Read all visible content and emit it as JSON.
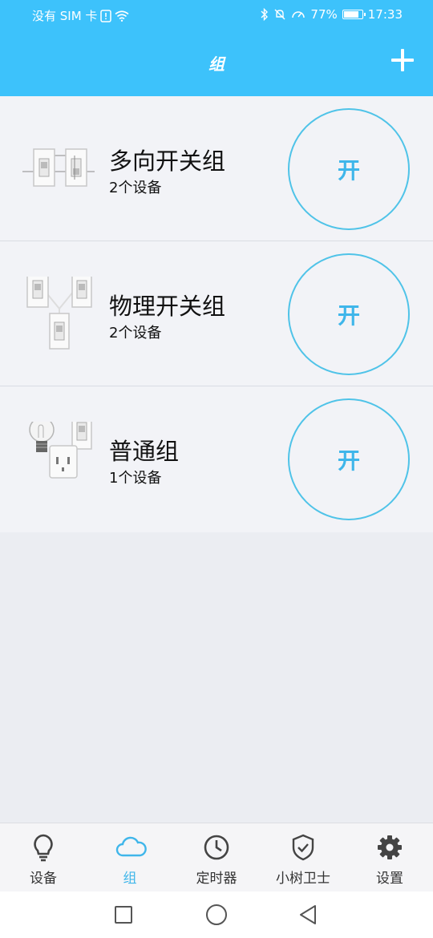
{
  "status_bar": {
    "carrier": "没有 SIM 卡",
    "battery": "77%",
    "time": "17:33"
  },
  "header": {
    "title": "组",
    "add_icon": "plus-icon"
  },
  "groups": [
    {
      "name": "多向开关组",
      "count": "2个设备",
      "button": "开",
      "icon": "multi-switch-group-icon"
    },
    {
      "name": "物理开关组",
      "count": "2个设备",
      "button": "开",
      "icon": "physical-switch-group-icon"
    },
    {
      "name": "普通组",
      "count": "1个设备",
      "button": "开",
      "icon": "normal-group-icon"
    }
  ],
  "tabs": [
    {
      "label": "设备",
      "icon": "bulb-icon",
      "active": false
    },
    {
      "label": "组",
      "icon": "cloud-icon",
      "active": true
    },
    {
      "label": "定时器",
      "icon": "clock-icon",
      "active": false
    },
    {
      "label": "小树卫士",
      "icon": "shield-check-icon",
      "active": false
    },
    {
      "label": "设置",
      "icon": "gear-icon",
      "active": false
    }
  ],
  "colors": {
    "header_bg": "#3dc2fb",
    "accent": "#3fb6ea"
  }
}
